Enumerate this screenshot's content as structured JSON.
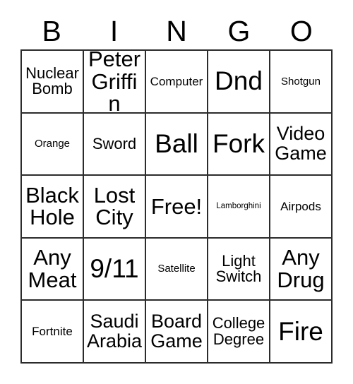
{
  "card": {
    "title": "Bingo Card",
    "header": {
      "letters": [
        "B",
        "I",
        "N",
        "G",
        "O"
      ]
    },
    "grid": {
      "rows": 5,
      "columns": 5,
      "border_color": "#2b2b2b",
      "cell_background": "#ffffff",
      "text_color": "#000000",
      "free_space": {
        "row": 3,
        "column": 3,
        "label": "Free!"
      },
      "cells": [
        [
          {
            "label": "Nuclear Bomb",
            "size": "md"
          },
          {
            "label": "Peter Griffin",
            "size": "xl"
          },
          {
            "label": "Computer",
            "size": "sm"
          },
          {
            "label": "Dnd",
            "size": "xxl"
          },
          {
            "label": "Shotgun",
            "size": "xs"
          }
        ],
        [
          {
            "label": "Orange",
            "size": "xs"
          },
          {
            "label": "Sword",
            "size": "md"
          },
          {
            "label": "Ball",
            "size": "xxl"
          },
          {
            "label": "Fork",
            "size": "xxl"
          },
          {
            "label": "Video Game",
            "size": "lg"
          }
        ],
        [
          {
            "label": "Black Hole",
            "size": "xl"
          },
          {
            "label": "Lost City",
            "size": "xl"
          },
          {
            "label": "Free!",
            "size": "xl"
          },
          {
            "label": "Lamborghini",
            "size": "xxs"
          },
          {
            "label": "Airpods",
            "size": "sm"
          }
        ],
        [
          {
            "label": "Any Meat",
            "size": "xl"
          },
          {
            "label": "9/11",
            "size": "xxl"
          },
          {
            "label": "Satellite",
            "size": "xs"
          },
          {
            "label": "Light Switch",
            "size": "md"
          },
          {
            "label": "Any Drug",
            "size": "xl"
          }
        ],
        [
          {
            "label": "Fortnite",
            "size": "sm"
          },
          {
            "label": "Saudi Arabia",
            "size": "lg"
          },
          {
            "label": "Board Game",
            "size": "lg"
          },
          {
            "label": "College Degree",
            "size": "md"
          },
          {
            "label": "Fire",
            "size": "xxl"
          }
        ]
      ]
    }
  }
}
